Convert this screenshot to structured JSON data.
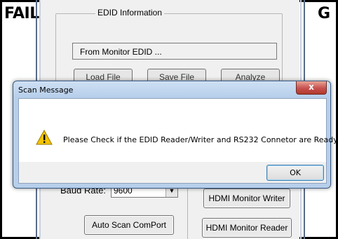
{
  "labels": {
    "left": "FAIL",
    "right": "G"
  },
  "app": {
    "group_title": "EDID Information",
    "edid_source": "From Monitor EDID ...",
    "file_buttons": [
      "Load File",
      "Save File",
      "Analyze"
    ],
    "baud_label": "Baud Rate:",
    "baud_value": "9600",
    "auto_scan_label": "Auto Scan ComPort",
    "hdmi_writer_label": "HDMI Monitor Writer",
    "hdmi_reader_label": "HDMI Monitor Reader"
  },
  "dialog": {
    "title": "Scan Message",
    "close_glyph": "x",
    "icon": "warning-icon",
    "message": "Please Check if the EDID Reader/Writer and RS232 Connetor are Ready.",
    "ok_label": "OK"
  },
  "colors": {
    "dialog_frame": "#b7cfeb",
    "close_button": "#c75050",
    "warning_yellow": "#f5c400"
  }
}
